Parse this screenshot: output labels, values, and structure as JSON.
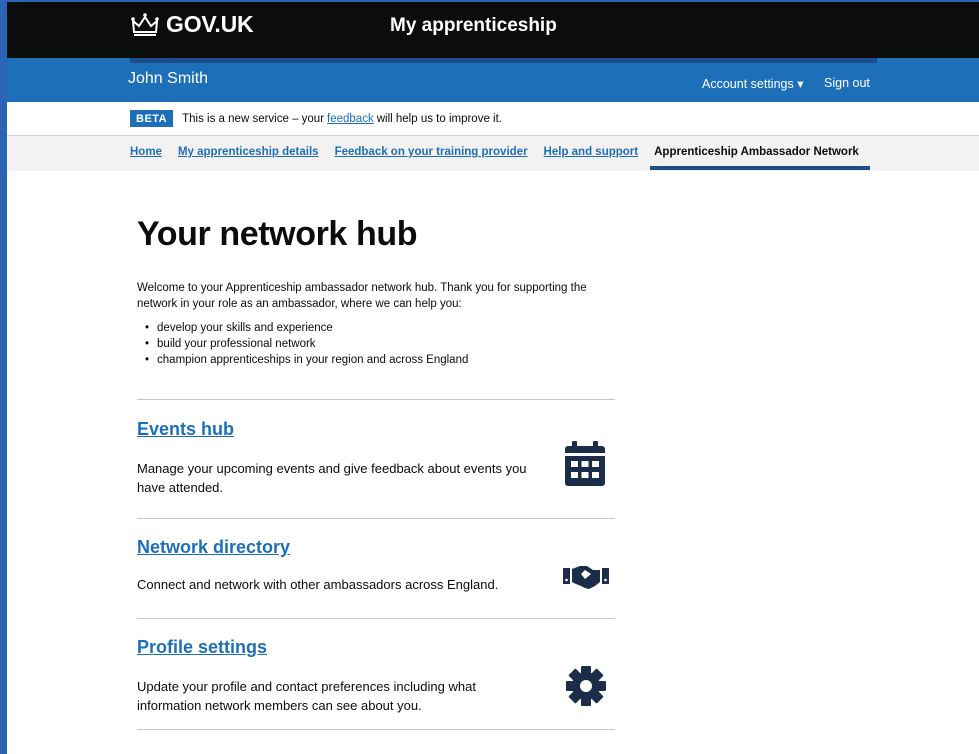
{
  "header": {
    "logo_text": "GOV.UK",
    "service_name": "My apprenticeship",
    "user_name": "John Smith",
    "account_settings": "Account settings ▾",
    "sign_out": "Sign out"
  },
  "beta": {
    "tag": "BETA",
    "text_before": "This is a new service – your",
    "link": "feedback",
    "text_after": "will help us to improve it."
  },
  "nav": {
    "items": [
      {
        "label": "Home"
      },
      {
        "label": "My apprenticeship details"
      },
      {
        "label": "Feedback on your training provider"
      },
      {
        "label": "Help and support"
      },
      {
        "label": "Apprenticeship Ambassador Network"
      }
    ]
  },
  "main": {
    "title": "Your network hub",
    "intro": "Welcome to your Apprenticeship ambassador network hub. Thank you for supporting the network in your role as an ambassador, where we can help you:",
    "bullets": [
      "develop your skills and experience",
      "build your professional network",
      "champion apprenticeships in your region and across England"
    ],
    "cards": [
      {
        "title": "Events hub",
        "description": "Manage your upcoming events and give feedback about events you have attended.",
        "icon": "calendar-icon"
      },
      {
        "title": "Network directory",
        "description": "Connect and network with other ambassadors across England.",
        "icon": "handshake-icon"
      },
      {
        "title": "Profile settings",
        "description": "Update your profile and contact preferences including what information network members can see about you.",
        "icon": "gear-icon"
      }
    ]
  },
  "colors": {
    "header_black": "#0b0c0c",
    "brand_blue": "#1d70b8",
    "icon_navy": "#1c2d4a",
    "nav_grey": "#f3f2f1"
  }
}
